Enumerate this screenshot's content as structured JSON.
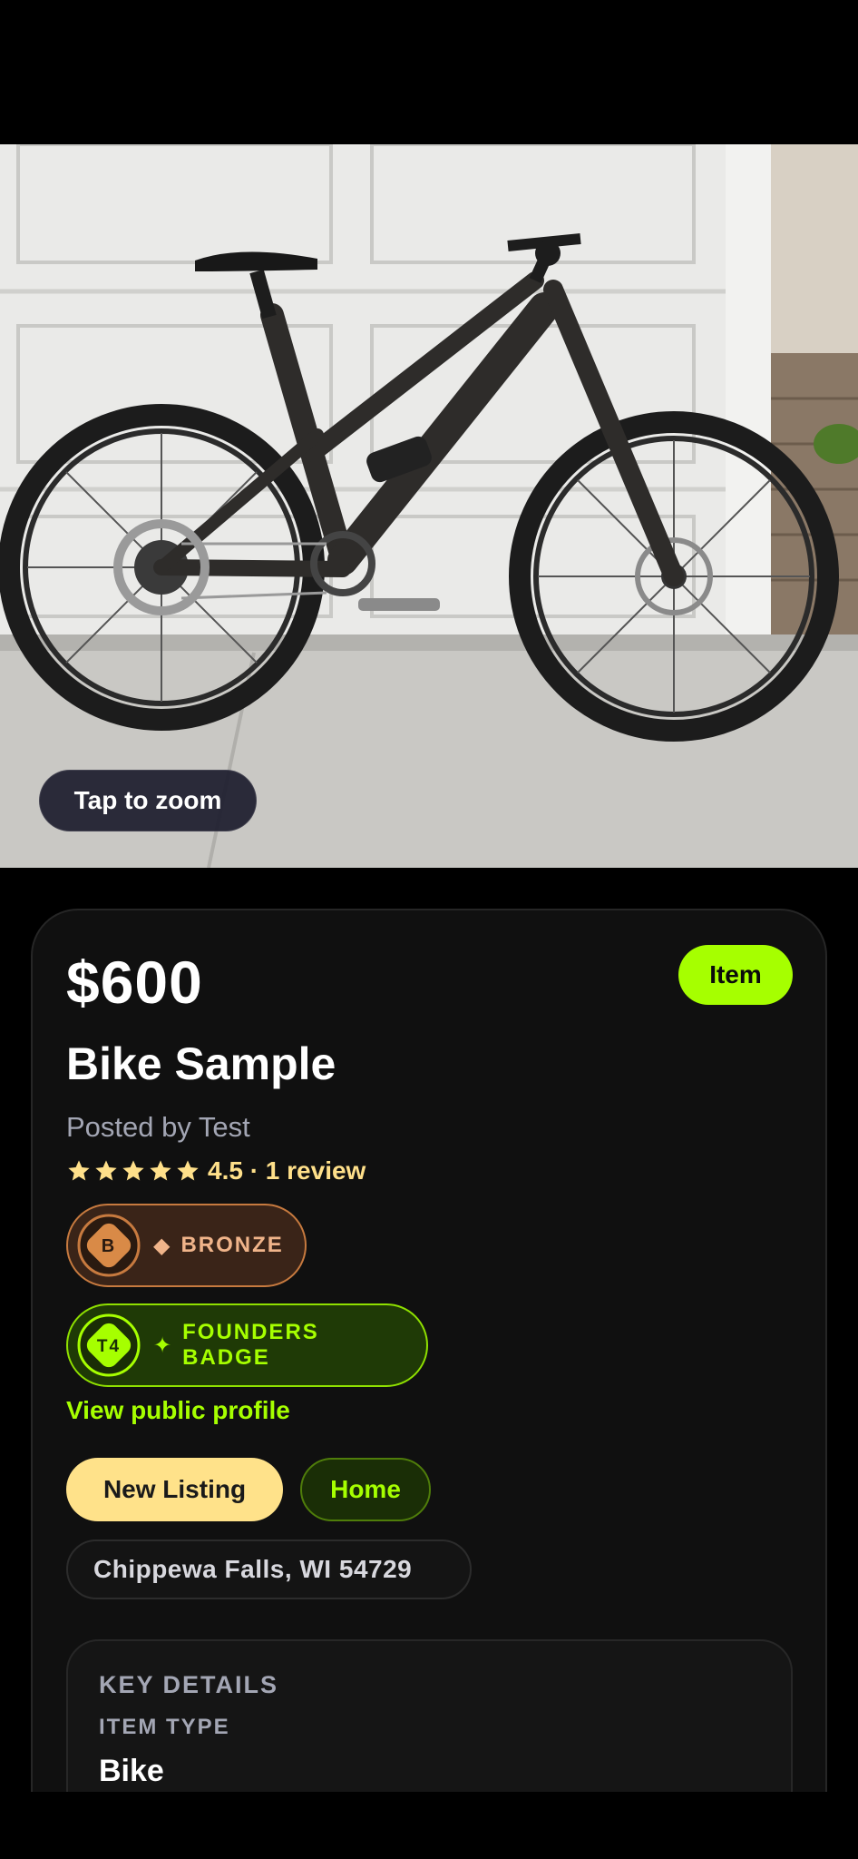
{
  "photo": {
    "alt": "Full suspension mountain bike against a garage door",
    "zoom_label": "Tap to zoom"
  },
  "listing": {
    "price": "$600",
    "type_label": "Item",
    "title": "Bike Sample",
    "posted_by": "Posted by Test",
    "rating": {
      "stars": 5,
      "text": "4.5 · 1 review"
    },
    "badges": [
      {
        "emblem": "B",
        "symbol": "◆",
        "label": "BRONZE",
        "color": "#c77a3f"
      },
      {
        "emblem": "T4",
        "symbol": "✦",
        "label": "FOUNDERS BADGE",
        "color": "#a6ff00"
      }
    ],
    "view_profile_label": "View public profile",
    "tags": [
      {
        "label": "New Listing"
      },
      {
        "label": "Home"
      }
    ],
    "location": "Chippewa Falls, WI 54729"
  },
  "key_details": {
    "heading": "KEY DETAILS",
    "item_type_label": "ITEM TYPE",
    "item_type_value": "Bike"
  },
  "colors": {
    "accent": "#a6ff00",
    "star": "#ffe08a",
    "bronze": "#c77a3f",
    "card_bg": "#101010"
  }
}
